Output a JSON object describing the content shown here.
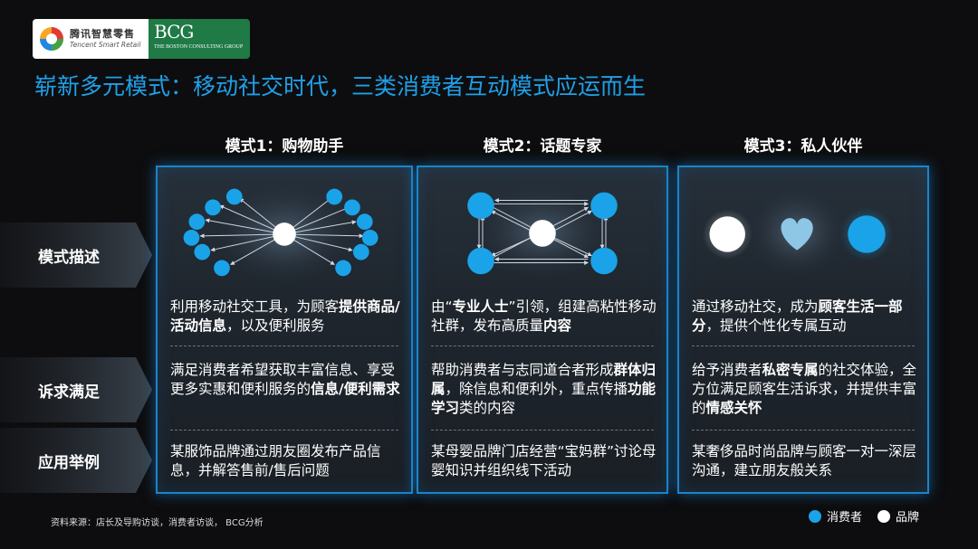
{
  "logos": {
    "tencent_cn": "腾讯智慧零售",
    "tencent_en": "Tencent Smart Retail",
    "bcg_big": "BCG",
    "bcg_small": "THE BOSTON CONSULTING GROUP"
  },
  "title": "崭新多元模式：移动社交时代，三类消费者互动模式应运而生",
  "columns": [
    {
      "header": "模式1：购物助手",
      "desc": [
        {
          "t": "利用移动社交工具，为顾客"
        },
        {
          "t": "提供商品/活动信息",
          "b": true
        },
        {
          "t": "，以及便利服务"
        }
      ],
      "need": [
        {
          "t": "满足消费者希望获取丰富信息、享受更多实惠和便利服务的"
        },
        {
          "t": "信息/便利需求",
          "b": true
        }
      ],
      "example": [
        {
          "t": "某服饰品牌通过朋友圈发布产品信息，并解答售前/售后问题"
        }
      ]
    },
    {
      "header": "模式2：话题专家",
      "desc": [
        {
          "t": "由“"
        },
        {
          "t": "专业人士",
          "b": true
        },
        {
          "t": "”引领，组建高粘性移动社群，发布高质量"
        },
        {
          "t": "内容",
          "b": true
        }
      ],
      "need": [
        {
          "t": "帮助消费者与志同道合者形成"
        },
        {
          "t": "群体归属",
          "b": true
        },
        {
          "t": "，除信息和便利外，重点传播"
        },
        {
          "t": "功能学习",
          "b": true
        },
        {
          "t": "类的内容"
        }
      ],
      "example": [
        {
          "t": "某母婴品牌门店经营“宝妈群”讨论母婴知识并组织线下活动"
        }
      ]
    },
    {
      "header": "模式3：私人伙伴",
      "desc": [
        {
          "t": "通过移动社交，成为"
        },
        {
          "t": "顾客生活一部分",
          "b": true
        },
        {
          "t": "，提供个性化专属互动"
        }
      ],
      "need": [
        {
          "t": "给予消费者"
        },
        {
          "t": "私密专属",
          "b": true
        },
        {
          "t": "的社交体验，全方位满足顾客生活诉求，并提供丰富的"
        },
        {
          "t": "情感关怀",
          "b": true
        }
      ],
      "example": [
        {
          "t": "某奢侈品时尚品牌与顾客一对一深层沟通，建立朋友般关系"
        }
      ]
    }
  ],
  "row_labels": [
    "模式描述",
    "诉求满足",
    "应用举例"
  ],
  "source": "资料来源：店长及导购访谈，消费者访谈， BCG分析",
  "legend": {
    "consumer_label": "消费者",
    "brand_label": "品牌",
    "consumer_color": "#1aa3e8",
    "brand_color": "#ffffff"
  },
  "colors": {
    "title": "#1fa0e8",
    "panel_border": "#1b84c8",
    "node_blue": "#1aa3e8"
  }
}
